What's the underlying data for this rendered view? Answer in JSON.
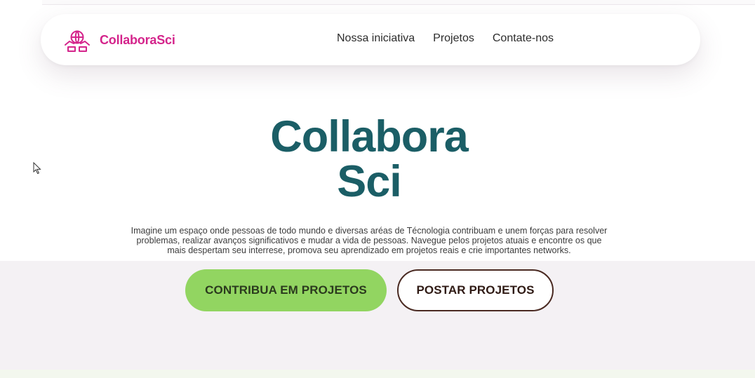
{
  "nav": {
    "brand_name": "CollaboraSci",
    "links": [
      {
        "label": "Nossa iniciativa"
      },
      {
        "label": "Projetos"
      },
      {
        "label": "Contate-nos"
      }
    ]
  },
  "hero": {
    "title_line1": "Collabora",
    "title_line2": "Sci",
    "description": "Imagine um espaço onde pessoas de todo mundo e diversas aréas de Técnologia contribuam e unem forças para resolver problemas, realizar avanços significativos e mudar a vida de pessoas. Navegue pelos projetos atuais e encontre os que mais despertam seu interrese, promova seu aprendizado em projetos reais e crie importantes networks."
  },
  "actions": {
    "primary_label": "CONTRIBUA EM PROJETOS",
    "secondary_label": "POSTAR PROJETOS"
  },
  "colors": {
    "brand": "#d4248b",
    "title": "#1b5e66",
    "primary_button": "#92d561",
    "secondary_border": "#4a2a22"
  },
  "icons": {
    "logo": "collaboration-hands-icon",
    "cursor": "mouse-pointer-icon"
  }
}
